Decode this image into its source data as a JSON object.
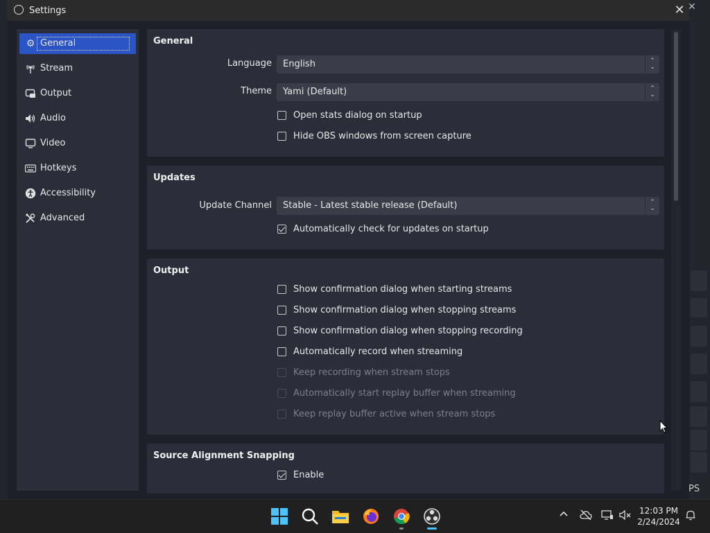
{
  "window": {
    "title": "Settings"
  },
  "sidebar": {
    "items": [
      {
        "label": "General",
        "icon": "gear-icon",
        "active": true
      },
      {
        "label": "Stream",
        "icon": "antenna-icon"
      },
      {
        "label": "Output",
        "icon": "output-icon"
      },
      {
        "label": "Audio",
        "icon": "speaker-icon"
      },
      {
        "label": "Video",
        "icon": "monitor-icon"
      },
      {
        "label": "Hotkeys",
        "icon": "keyboard-icon"
      },
      {
        "label": "Accessibility",
        "icon": "accessibility-icon"
      },
      {
        "label": "Advanced",
        "icon": "tools-icon"
      }
    ]
  },
  "general": {
    "title": "General",
    "language_label": "Language",
    "language_value": "English",
    "theme_label": "Theme",
    "theme_value": "Yami (Default)",
    "open_stats": "Open stats dialog on startup",
    "hide_obs": "Hide OBS windows from screen capture"
  },
  "updates": {
    "title": "Updates",
    "channel_label": "Update Channel",
    "channel_value": "Stable - Latest stable release (Default)",
    "auto_check": "Automatically check for updates on startup"
  },
  "output": {
    "title": "Output",
    "items": [
      "Show confirmation dialog when starting streams",
      "Show confirmation dialog when stopping streams",
      "Show confirmation dialog when stopping recording",
      "Automatically record when streaming",
      "Keep recording when stream stops",
      "Automatically start replay buffer when streaming",
      "Keep replay buffer active when stream stops"
    ]
  },
  "snapping": {
    "title": "Source Alignment Snapping",
    "enable": "Enable"
  },
  "background": {
    "ps_text": "PS"
  },
  "taskbar": {
    "time": "12:03 PM",
    "date": "2/24/2024",
    "colors": {
      "accent": "#2b55c7",
      "bg": "#202020"
    }
  }
}
